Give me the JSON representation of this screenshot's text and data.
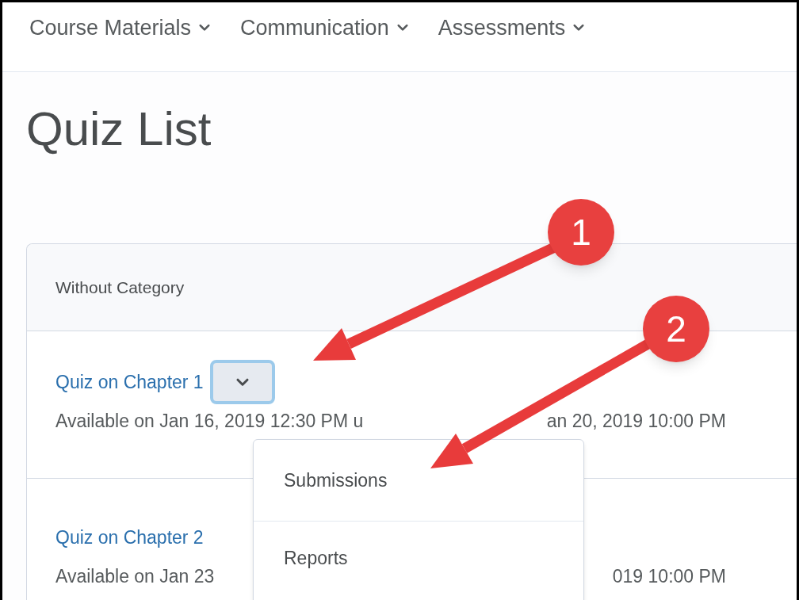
{
  "nav": [
    {
      "label": "Course Materials"
    },
    {
      "label": "Communication"
    },
    {
      "label": "Assessments"
    }
  ],
  "heading": "Quiz List",
  "category": "Without Category",
  "quizzes": [
    {
      "title": "Quiz on Chapter 1",
      "availability": [
        "Available on Jan 16, 2019 12:30 PM u",
        "an 20, 2019 10:00 PM"
      ],
      "actions_open": true
    },
    {
      "title": "Quiz on Chapter 2",
      "availability": [
        "Available on Jan 23",
        "019 10:00 PM"
      ],
      "actions_open": false
    }
  ],
  "menu": {
    "items": [
      "Submissions",
      "Reports"
    ]
  },
  "annotations": [
    "1",
    "2"
  ]
}
